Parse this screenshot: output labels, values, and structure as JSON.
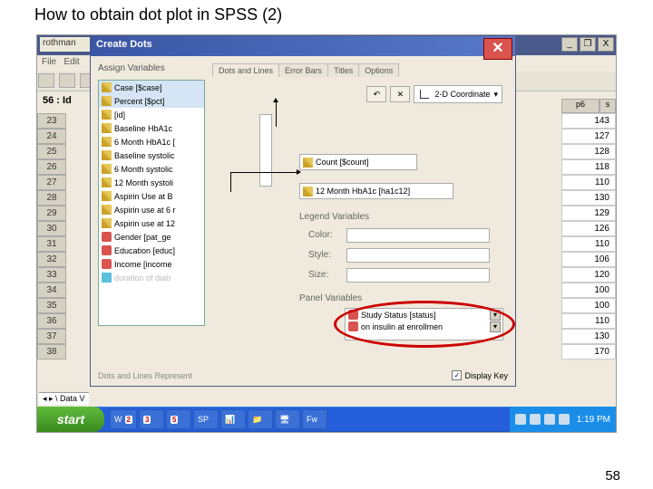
{
  "slide": {
    "title": "How to obtain dot plot in SPSS (2)",
    "page": "58"
  },
  "spss": {
    "doc": "rothman",
    "menu": [
      "File",
      "Edit"
    ],
    "cell": "56 : Id",
    "rows": [
      "23",
      "24",
      "25",
      "26",
      "27",
      "28",
      "29",
      "30",
      "31",
      "32",
      "33",
      "34",
      "35",
      "36",
      "37",
      "38"
    ],
    "rightHead1": "p6",
    "rightHead2": "s",
    "rightVals": [
      "143",
      "127",
      "128",
      "118",
      "110",
      "130",
      "129",
      "126",
      "110",
      "106",
      "120",
      "100",
      "100",
      "110",
      "130",
      "170"
    ],
    "dataview": "◂ ▸ \\ Data V"
  },
  "dlg": {
    "title": "Create Dots",
    "assign": "Assign Variables",
    "tabs": [
      "Dots and Lines",
      "Error Bars",
      "Titles",
      "Options"
    ],
    "coord": "2-D Coordinate",
    "vars": [
      "Case [$case]",
      "Percent [$pct]",
      "[id]",
      "Baseline HbA1c",
      "6 Month HbA1c [",
      "Baseline systolic",
      "6 Month systolic",
      "12 Month systoli",
      "Aspirin Use at B",
      "Aspirin use at 6 r",
      "Aspirin use at 12",
      "Gender [pat_ge",
      "Education [educ]",
      "Income [income",
      "duration of diab"
    ],
    "yCount": "Count [$count]",
    "xVar": "12 Month HbA1c [ha1c12]",
    "legend": "Legend Variables",
    "color": "Color:",
    "style": "Style:",
    "size": "Size:",
    "panel": "Panel Variables",
    "pvar1": "Study Status [status]",
    "pvar2": "on insulin at enrollmen",
    "represent": "Dots and Lines Represent",
    "displayKey": "Display Key"
  },
  "taskbar": {
    "start": "start",
    "items": [
      {
        "label": "W",
        "count": "2"
      },
      {
        "label": "",
        "count": "3"
      },
      {
        "label": "",
        "count": "5"
      },
      {
        "label": "SP",
        "count": ""
      },
      {
        "label": "",
        "count": ""
      },
      {
        "label": "",
        "count": ""
      },
      {
        "label": "",
        "count": ""
      },
      {
        "label": "Fw",
        "count": ""
      }
    ],
    "time": "1:19 PM"
  }
}
